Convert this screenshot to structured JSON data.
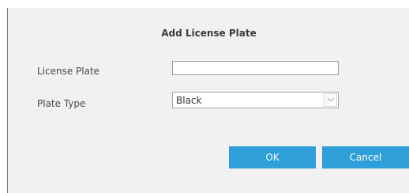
{
  "dialog": {
    "title": "Add License Plate",
    "license_plate_label": "License Plate",
    "license_plate_value": "",
    "plate_type_label": "Plate Type",
    "plate_type_selected": "Black",
    "ok_label": "OK",
    "cancel_label": "Cancel"
  },
  "colors": {
    "dialog_background": "#f1f1f1",
    "button_accent": "#2e9fd8",
    "button_text": "#ffffff"
  },
  "icons": {
    "select_arrow": "chevron-down-icon"
  }
}
